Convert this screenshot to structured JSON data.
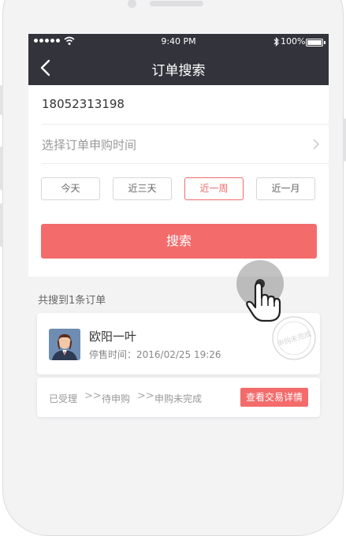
{
  "status_bar": {
    "time": "9:40 PM",
    "battery": "100%"
  },
  "nav": {
    "title": "订单搜索",
    "back_icon": "chevron-left-icon"
  },
  "form": {
    "phone_value": "18052313198",
    "date_placeholder": "选择订单申购时间",
    "date_icon": "chevron-right-icon",
    "chips": [
      {
        "label": "今天",
        "active": false
      },
      {
        "label": "近三天",
        "active": false
      },
      {
        "label": "近一周",
        "active": true
      },
      {
        "label": "近一月",
        "active": false
      }
    ],
    "search_label": "搜索"
  },
  "results": {
    "count_text": "共搜到1条订单",
    "orders": [
      {
        "name": "欧阳一叶",
        "stop_time": "停售时间：2016/02/25 19:26",
        "stamp_text": "申购未完成",
        "steps": [
          "已受理",
          "待申购",
          "申购未完成"
        ],
        "step_separator": ">>",
        "detail_label": "查看交易详情"
      }
    ]
  },
  "colors": {
    "nav_bg": "#33333c",
    "accent": "#f36b6b",
    "page_bg": "#f3f3f4"
  }
}
